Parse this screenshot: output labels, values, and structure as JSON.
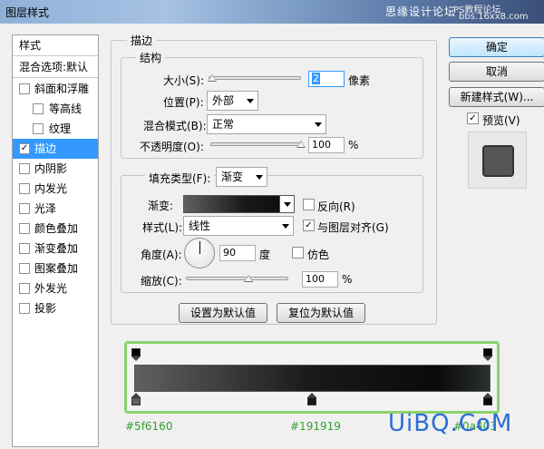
{
  "window": {
    "title": "图层样式",
    "watermark_top": "思缘设计论坛",
    "watermark_top2": "PS教程论坛",
    "watermark_top3": "bbs.16xx8.com",
    "watermark_bottom": "UiBQ.CoM"
  },
  "sidebar": {
    "header": "样式",
    "blend_options": "混合选项:默认",
    "items": [
      {
        "label": "斜面和浮雕",
        "checked": false,
        "indent": false
      },
      {
        "label": "等高线",
        "checked": false,
        "indent": true
      },
      {
        "label": "纹理",
        "checked": false,
        "indent": true
      },
      {
        "label": "描边",
        "checked": true,
        "indent": false,
        "selected": true
      },
      {
        "label": "内阴影",
        "checked": false,
        "indent": false
      },
      {
        "label": "内发光",
        "checked": false,
        "indent": false
      },
      {
        "label": "光泽",
        "checked": false,
        "indent": false
      },
      {
        "label": "颜色叠加",
        "checked": false,
        "indent": false
      },
      {
        "label": "渐变叠加",
        "checked": false,
        "indent": false
      },
      {
        "label": "图案叠加",
        "checked": false,
        "indent": false
      },
      {
        "label": "外发光",
        "checked": false,
        "indent": false
      },
      {
        "label": "投影",
        "checked": false,
        "indent": false
      }
    ]
  },
  "stroke": {
    "group_title": "描边",
    "structure_title": "结构",
    "size_label": "大小(S):",
    "size_value": "2",
    "size_unit": "像素",
    "position_label": "位置(P):",
    "position_value": "外部",
    "blend_label": "混合模式(B):",
    "blend_value": "正常",
    "opacity_label": "不透明度(O):",
    "opacity_value": "100",
    "opacity_unit": "%"
  },
  "fill": {
    "type_label": "填充类型(F):",
    "type_value": "渐变",
    "gradient_label": "渐变:",
    "reverse_label": "反向(R)",
    "reverse_checked": false,
    "style_label": "样式(L):",
    "style_value": "线性",
    "align_label": "与图层对齐(G)",
    "align_checked": true,
    "angle_label": "角度(A):",
    "angle_value": "90",
    "angle_unit": "度",
    "dither_label": "仿色",
    "dither_checked": false,
    "scale_label": "缩放(C):",
    "scale_value": "100",
    "scale_unit": "%"
  },
  "defaults": {
    "set_default": "设置为默认值",
    "reset_default": "复位为默认值"
  },
  "right": {
    "ok": "确定",
    "cancel": "取消",
    "new_style": "新建样式(W)...",
    "preview_label": "预览(V)",
    "preview_checked": true
  },
  "gradient_stops": {
    "left_color": "#5f6160",
    "mid_color": "#191919",
    "right_color": "#0a0a0a",
    "left_label": "#5f6160",
    "mid_label": "#191919",
    "right_label": "#0a403"
  }
}
